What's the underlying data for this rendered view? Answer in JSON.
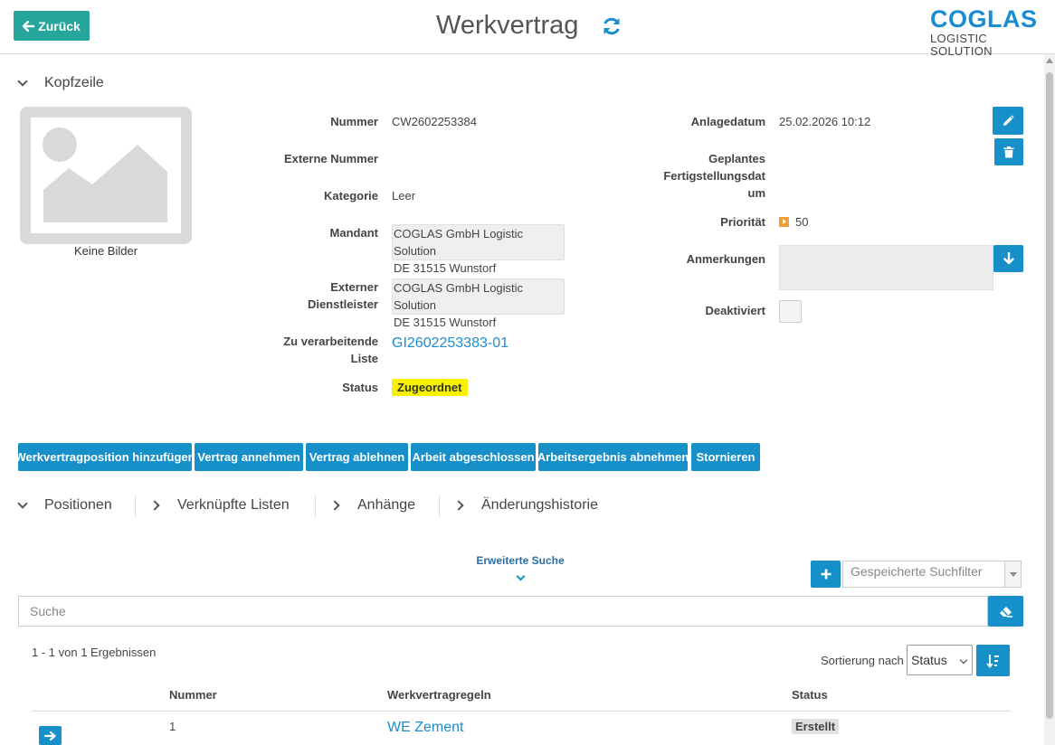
{
  "header": {
    "back_label": "Zurück",
    "title": "Werkvertrag",
    "logo_main": "COGLAS",
    "logo_sub": "LOGISTIC SOLUTION"
  },
  "sections": {
    "head": "Kopfzeile"
  },
  "image": {
    "empty_label": "Keine Bilder"
  },
  "fields": {
    "nummer_label": "Nummer",
    "nummer_value": "CW2602253384",
    "externe_nummer_label": "Externe Nummer",
    "kategorie_label": "Kategorie",
    "kategorie_value": "Leer",
    "mandant_label": "Mandant",
    "mandant_line1": "COGLAS GmbH Logistic Solution",
    "mandant_line2": "DE 31515 Wunstorf",
    "ext_dl_label_1": "Externer",
    "ext_dl_label_2": "Dienstleister",
    "ext_dl_line1": "COGLAS GmbH Logistic Solution",
    "ext_dl_line2": "DE 31515 Wunstorf",
    "liste_label_1": "Zu verarbeitende",
    "liste_label_2": "Liste",
    "liste_value": "GI2602253383-01",
    "status_label": "Status",
    "status_value": "Zugeordnet",
    "anlagedatum_label": "Anlagedatum",
    "anlagedatum_value": "25.02.2026 10:12",
    "geplant_label_1": "Geplantes",
    "geplant_label_2": "Fertigstellungsdat",
    "geplant_label_3": "um",
    "prioritaet_label": "Priorität",
    "prioritaet_value": "50",
    "anmerkungen_label": "Anmerkungen",
    "deaktiviert_label": "Deaktiviert"
  },
  "actions": [
    "Werkvertragposition hinzufügen",
    "Vertrag annehmen",
    "Vertrag ablehnen",
    "Arbeit abgeschlossen",
    "Arbeitsergebnis abnehmen",
    "Stornieren"
  ],
  "tabs": [
    "Positionen",
    "Verknüpfte Listen",
    "Anhänge",
    "Änderungshistorie"
  ],
  "search": {
    "advanced_label": "Erweiterte Suche",
    "saved_filters_placeholder": "Gespeicherte Suchfilter",
    "placeholder": "Suche",
    "results_text": "1 - 1 von 1 Ergebnissen",
    "sort_label": "Sortierung nach",
    "sort_value": "Status"
  },
  "table": {
    "columns": [
      "Nummer",
      "Werkvertragregeln",
      "Status"
    ],
    "rows": [
      {
        "nummer": "1",
        "regel": "WE Zement",
        "status": "Erstellt"
      }
    ]
  },
  "colors": {
    "primary": "#1790c9",
    "back_button": "#26a69a",
    "status_highlight": "#f8f200",
    "priority": "#f0a030"
  },
  "icons": {
    "back": "arrow-left-icon",
    "refresh": "refresh-icon",
    "edit": "pencil-icon",
    "delete": "trash-icon",
    "download": "arrow-down-icon",
    "add": "plus-icon",
    "clear": "eraser-icon",
    "sort": "sort-icon",
    "open": "arrow-right-icon",
    "priority": "priority-icon"
  }
}
